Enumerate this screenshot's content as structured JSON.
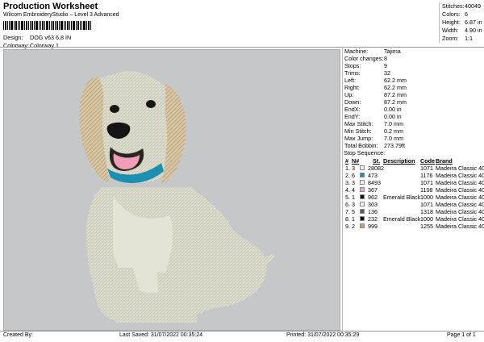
{
  "header": {
    "title": "Production Worksheet",
    "subtitle": "Wilcom EmbroideryStudio – Level 3 Advanced",
    "design_label": "Design:",
    "design_value": "DOG v63 6,8 IN",
    "colorway_label": "Colorway:",
    "colorway_value": "Colorway 1"
  },
  "summary": {
    "stitches_label": "Stitches:",
    "stitches": "40049",
    "colors_label": "Colors:",
    "colors": "6",
    "height_label": "Height:",
    "height": "6.87 in",
    "width_label": "Width:",
    "width": "4.90 in",
    "zoom_label": "Zoom:",
    "zoom": "1:1"
  },
  "info": [
    {
      "k": "Machine:",
      "v": "Tajima"
    },
    {
      "k": "Color changes:",
      "v": "8"
    },
    {
      "k": "Stops:",
      "v": "9"
    },
    {
      "k": "Trims:",
      "v": "32"
    },
    {
      "k": "Left:",
      "v": "62.2 mm"
    },
    {
      "k": "Right:",
      "v": "62.2 mm"
    },
    {
      "k": "Up:",
      "v": "87.2 mm"
    },
    {
      "k": "Down:",
      "v": "87.2 mm"
    },
    {
      "k": "EndX:",
      "v": "0.00 in"
    },
    {
      "k": "EndY:",
      "v": "0.00 in"
    },
    {
      "k": "Max Stitch:",
      "v": "7.0 mm"
    },
    {
      "k": "Min Stitch:",
      "v": "0.2 mm"
    },
    {
      "k": "Max Jump:",
      "v": "7.0 mm"
    },
    {
      "k": "Total Bobbin:",
      "v": "273.79ft"
    }
  ],
  "sequence": {
    "title": "Stop Sequence:",
    "headers": {
      "num": "#",
      "n": "N#",
      "st": "St.",
      "desc": "Description",
      "code": "Code",
      "brand": "Brand"
    },
    "rows": [
      {
        "num": "1.",
        "n": "3",
        "color": "#f2f0ea",
        "st": "28082",
        "desc": "",
        "code": "1071",
        "brand": "Madeira Classic 40"
      },
      {
        "num": "2.",
        "n": "6",
        "color": "#1d8fb0",
        "st": "473",
        "desc": "",
        "code": "1176",
        "brand": "Madeira Classic 40"
      },
      {
        "num": "3.",
        "n": "3",
        "color": "#f2f0ea",
        "st": "8493",
        "desc": "",
        "code": "1071",
        "brand": "Madeira Classic 40"
      },
      {
        "num": "4.",
        "n": "4",
        "color": "#f0a9bd",
        "st": "367",
        "desc": "",
        "code": "1108",
        "brand": "Madeira Classic 40"
      },
      {
        "num": "5.",
        "n": "1",
        "color": "#111111",
        "st": "962",
        "desc": "Emerald Black",
        "code": "1000",
        "brand": "Madeira Classic 40"
      },
      {
        "num": "6.",
        "n": "3",
        "color": "#f2f0ea",
        "st": "303",
        "desc": "",
        "code": "1071",
        "brand": "Madeira Classic 40"
      },
      {
        "num": "7.",
        "n": "5",
        "color": "#5a5a58",
        "st": "136",
        "desc": "",
        "code": "1318",
        "brand": "Madeira Classic 40"
      },
      {
        "num": "8.",
        "n": "1",
        "color": "#111111",
        "st": "232",
        "desc": "Emerald Black",
        "code": "1000",
        "brand": "Madeira Classic 40"
      },
      {
        "num": "9.",
        "n": "2",
        "color": "#c9a07a",
        "st": "999",
        "desc": "",
        "code": "1255",
        "brand": "Madeira Classic 40"
      }
    ]
  },
  "footer": {
    "created": "Created By:",
    "saved": "Last Saved: 31/07/2022 00:35:24",
    "printed": "Printed: 31/07/2022 00:35:29",
    "page": "Page 1 of 1"
  }
}
